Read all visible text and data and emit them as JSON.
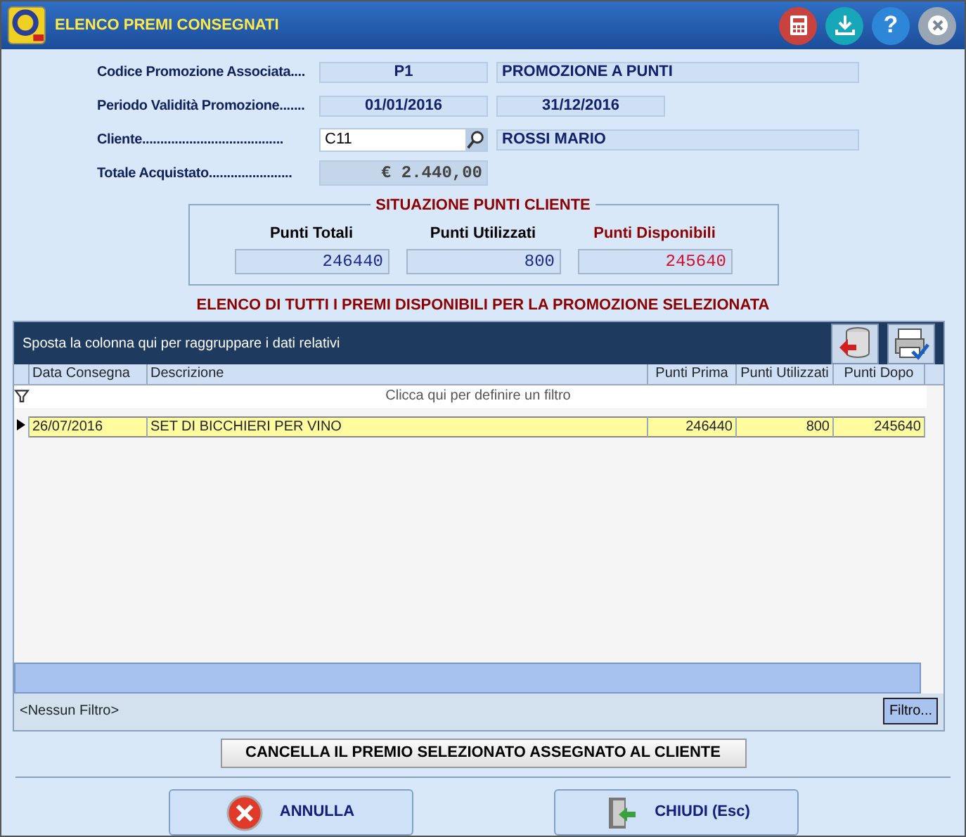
{
  "window": {
    "title": "ELENCO PREMI CONSEGNATI",
    "help_button": "?"
  },
  "form": {
    "promo_label": "Codice Promozione Associata....",
    "promo_code": "P1",
    "promo_name": "PROMOZIONE A PUNTI",
    "period_label": "Periodo Validità Promozione.......",
    "period_from": "01/01/2016",
    "period_to": "31/12/2016",
    "client_label": "Cliente.......................................",
    "client_code": "C11",
    "client_name": "ROSSI MARIO",
    "total_label": "Totale Acquistato.......................",
    "total_value": "€ 2.440,00"
  },
  "summary": {
    "title": "SITUAZIONE PUNTI CLIENTE",
    "items": [
      {
        "label": "Punti Totali",
        "value": "246440",
        "kind": "normal"
      },
      {
        "label": "Punti Utilizzati",
        "value": "800",
        "kind": "normal"
      },
      {
        "label": "Punti Disponibili",
        "value": "245640",
        "kind": "alert"
      }
    ]
  },
  "list_title": "ELENCO DI TUTTI I PREMI DISPONIBILI PER LA PROMOZIONE SELEZIONATA",
  "grid": {
    "group_hint": "Sposta la colonna qui per raggruppare i dati relativi",
    "columns": [
      "Data Consegna",
      "Descrizione",
      "Punti Prima",
      "Punti Utilizzati",
      "Punti Dopo"
    ],
    "filter_hint": "Clicca qui per definire un filtro",
    "rows": [
      {
        "cells": [
          "26/07/2016",
          "SET DI BICCHIERI PER VINO",
          "246440",
          "800",
          "245640"
        ],
        "selected": true
      }
    ],
    "filter_status": "<Nessun Filtro>",
    "filter_button": "Filtro..."
  },
  "delete_button": "CANCELLA IL PREMIO SELEZIONATO ASSEGNATO AL CLIENTE",
  "buttons": [
    {
      "label": "ANNULLA",
      "kind": "cancel"
    },
    {
      "label": "CHIUDI (Esc)",
      "kind": "close"
    }
  ]
}
